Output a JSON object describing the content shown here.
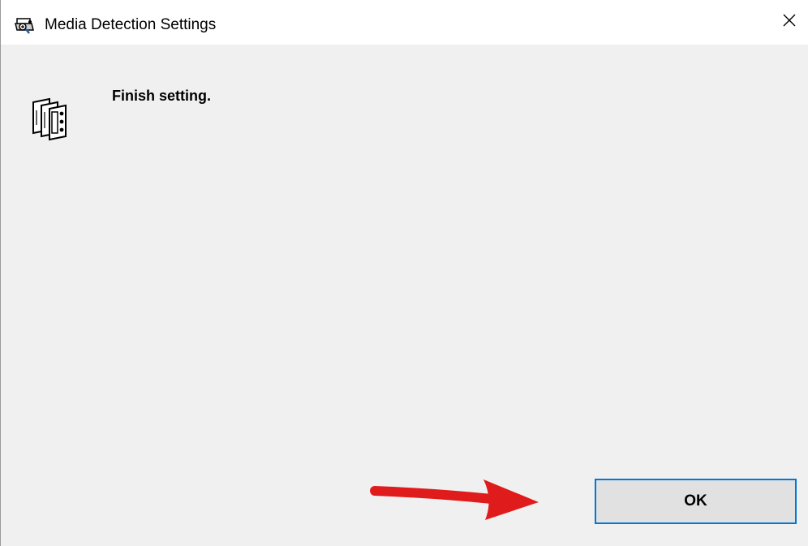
{
  "window": {
    "title": "Media Detection Settings",
    "app_icon": "printer-settings-icon",
    "close_icon": "close-icon"
  },
  "content": {
    "icon": "film-media-icon",
    "message": "Finish setting."
  },
  "buttons": {
    "ok_label": "OK"
  },
  "annotation": {
    "arrow_icon": "red-arrow-right-icon",
    "arrow_color": "#e01b1b"
  },
  "colors": {
    "accent": "#0078d7",
    "dialog_bg": "#f0f0f0",
    "titlebar_bg": "#ffffff",
    "button_bg": "#e1e1e1"
  }
}
